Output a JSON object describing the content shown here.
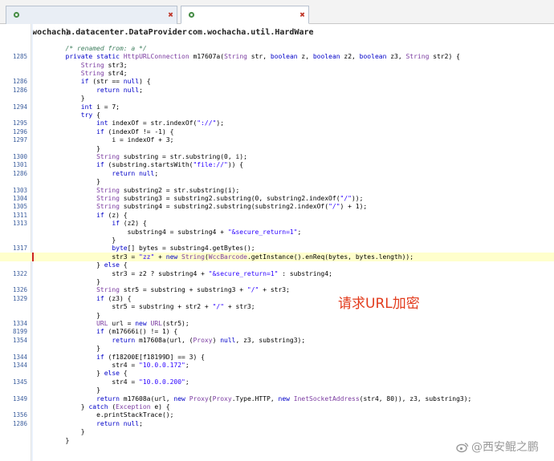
{
  "tabs": [
    {
      "label": "com.wochacha.datacenter.DataProvider"
    },
    {
      "label": "com.wochacha.util.HardWare"
    }
  ],
  "code_lines": [
    {
      "ln": "",
      "code": "        }"
    },
    {
      "ln": "",
      "code": ""
    },
    {
      "ln": "",
      "code": "        /* renamed from: a */"
    },
    {
      "ln": "1285",
      "code": "        private static HttpURLConnection m17607a(String str, boolean z, boolean z2, boolean z3, String str2) {"
    },
    {
      "ln": "",
      "code": "            String str3;"
    },
    {
      "ln": "",
      "code": "            String str4;"
    },
    {
      "ln": "1286",
      "code": "            if (str == null) {"
    },
    {
      "ln": "1286",
      "code": "                return null;"
    },
    {
      "ln": "",
      "code": "            }"
    },
    {
      "ln": "1294",
      "code": "            int i = 7;"
    },
    {
      "ln": "",
      "code": "            try {"
    },
    {
      "ln": "1295",
      "code": "                int indexOf = str.indexOf(\"://\");"
    },
    {
      "ln": "1296",
      "code": "                if (indexOf != -1) {"
    },
    {
      "ln": "1297",
      "code": "                    i = indexOf + 3;"
    },
    {
      "ln": "",
      "code": "                }"
    },
    {
      "ln": "1300",
      "code": "                String substring = str.substring(0, i);"
    },
    {
      "ln": "1301",
      "code": "                if (substring.startsWith(\"file://\")) {"
    },
    {
      "ln": "1286",
      "code": "                    return null;"
    },
    {
      "ln": "",
      "code": "                }"
    },
    {
      "ln": "1303",
      "code": "                String substring2 = str.substring(i);"
    },
    {
      "ln": "1304",
      "code": "                String substring3 = substring2.substring(0, substring2.indexOf(\"/\"));"
    },
    {
      "ln": "1305",
      "code": "                String substring4 = substring2.substring(substring2.indexOf(\"/\") + 1);"
    },
    {
      "ln": "1311",
      "code": "                if (z) {"
    },
    {
      "ln": "1313",
      "code": "                    if (z2) {"
    },
    {
      "ln": "",
      "code": "                        substring4 = substring4 + \"&secure_return=1\";"
    },
    {
      "ln": "",
      "code": "                    }"
    },
    {
      "ln": "1317",
      "code": "                    byte[] bytes = substring4.getBytes();"
    },
    {
      "ln": "",
      "code": "                    str3 = \"zz\" + new String(WccBarcode.getInstance().enReq(bytes, bytes.length));"
    },
    {
      "ln": "",
      "code": "                } else {"
    },
    {
      "ln": "1322",
      "code": "                    str3 = z2 ? substring4 + \"&secure_return=1\" : substring4;"
    },
    {
      "ln": "",
      "code": "                }"
    },
    {
      "ln": "1326",
      "code": "                String str5 = substring + substring3 + \"/\" + str3;"
    },
    {
      "ln": "1329",
      "code": "                if (z3) {"
    },
    {
      "ln": "",
      "code": "                    str5 = substring + str2 + \"/\" + str3;"
    },
    {
      "ln": "",
      "code": "                }"
    },
    {
      "ln": "1334",
      "code": "                URL url = new URL(str5);"
    },
    {
      "ln": "8199",
      "code": "                if (m17666i() != 1) {"
    },
    {
      "ln": "1354",
      "code": "                    return m17608a(url, (Proxy) null, z3, substring3);"
    },
    {
      "ln": "",
      "code": "                }"
    },
    {
      "ln": "1344",
      "code": "                if (f18200E[f18199D] == 3) {"
    },
    {
      "ln": "1344",
      "code": "                    str4 = \"10.0.0.172\";"
    },
    {
      "ln": "",
      "code": "                } else {"
    },
    {
      "ln": "1345",
      "code": "                    str4 = \"10.0.0.200\";"
    },
    {
      "ln": "",
      "code": "                }"
    },
    {
      "ln": "1349",
      "code": "                return m17608a(url, new Proxy(Proxy.Type.HTTP, new InetSocketAddress(str4, 80)), z3, substring3);"
    },
    {
      "ln": "",
      "code": "            } catch (Exception e) {"
    },
    {
      "ln": "1356",
      "code": "                e.printStackTrace();"
    },
    {
      "ln": "1286",
      "code": "                return null;"
    },
    {
      "ln": "",
      "code": "            }"
    },
    {
      "ln": "",
      "code": "        }"
    }
  ],
  "highlight_line_index": 27,
  "annotation": "请求URL加密",
  "watermark": "@西安鲲之鹏",
  "colors": {
    "keyword": "#0000c8",
    "type": "#7a3aa0",
    "string": "#2a00ff",
    "comment": "#3f7f5f",
    "line_number": "#3d5f9e",
    "highlight_bg": "#ffffcc",
    "annotation": "#e23b1c"
  },
  "icons": {
    "tab_file": "java-class-icon",
    "tab_close": "close-icon",
    "watermark": "weibo-icon"
  }
}
